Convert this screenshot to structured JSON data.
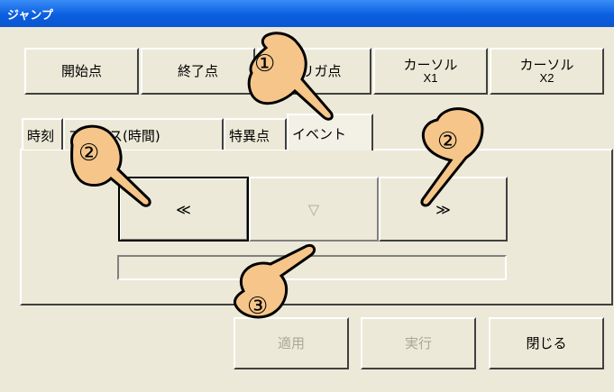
{
  "window": {
    "title": "ジャンプ"
  },
  "top_buttons": [
    {
      "label1": "開始点",
      "label2": ""
    },
    {
      "label1": "終了点",
      "label2": ""
    },
    {
      "label1": "トリガ点",
      "label2": ""
    },
    {
      "label1": "カーソル",
      "label2": "X1"
    },
    {
      "label1": "カーソル",
      "label2": "X2"
    }
  ],
  "tabs": [
    {
      "label": "時刻"
    },
    {
      "label": "アドレス(時間)"
    },
    {
      "label": "特異点"
    },
    {
      "label": "イベント"
    }
  ],
  "nav": {
    "prev": "≪",
    "down": "▽",
    "next": "≫"
  },
  "bottom": {
    "apply": "適用",
    "run": "実行",
    "close": "閉じる"
  },
  "callouts": {
    "c1": "①",
    "c2": "②",
    "c3": "③"
  }
}
